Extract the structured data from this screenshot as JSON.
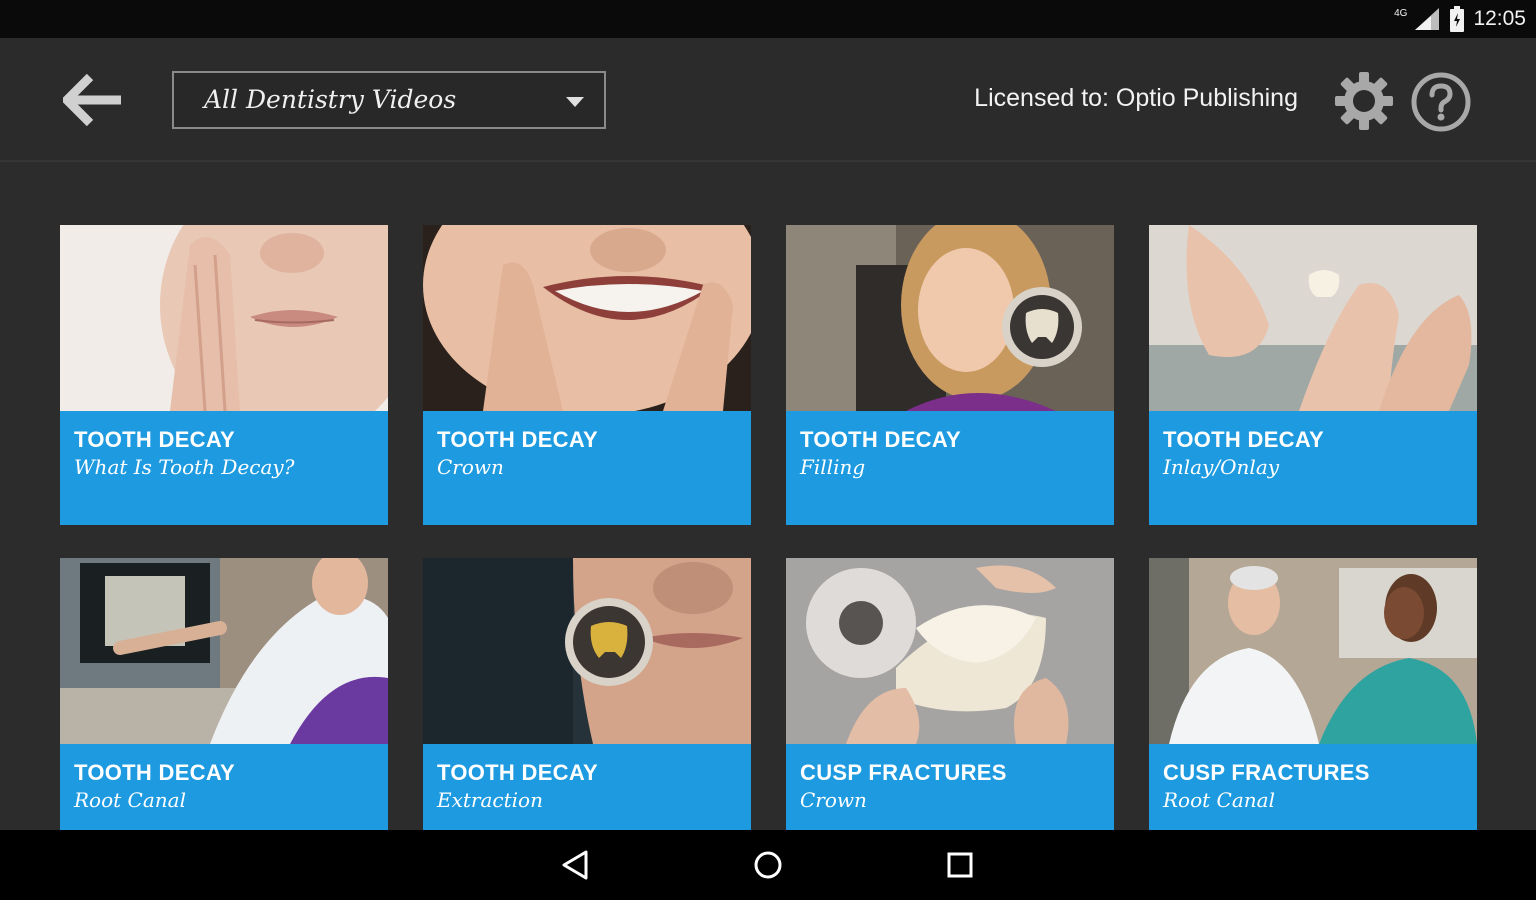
{
  "status_bar": {
    "time": "12:05",
    "network": "4G"
  },
  "header": {
    "dropdown_value": "All Dentistry Videos",
    "license_text": "Licensed to: Optio Publishing",
    "back_icon": "back-arrow-icon",
    "settings_icon": "gear-icon",
    "help_icon": "help-icon"
  },
  "colors": {
    "accent": "#1e9ae0",
    "background": "#2c2c2c",
    "status_bar": "#0a0a0a",
    "nav_bar": "#000000"
  },
  "videos": [
    {
      "title": "TOOTH DECAY",
      "subtitle": "What Is Tooth Decay?"
    },
    {
      "title": "TOOTH DECAY",
      "subtitle": "Crown"
    },
    {
      "title": "TOOTH DECAY",
      "subtitle": "Filling"
    },
    {
      "title": "TOOTH DECAY",
      "subtitle": "Inlay/Onlay"
    },
    {
      "title": "TOOTH DECAY",
      "subtitle": "Root Canal"
    },
    {
      "title": "TOOTH DECAY",
      "subtitle": "Extraction"
    },
    {
      "title": "CUSP FRACTURES",
      "subtitle": "Crown"
    },
    {
      "title": "CUSP FRACTURES",
      "subtitle": "Root Canal"
    }
  ],
  "nav": {
    "back": "nav-back-icon",
    "home": "nav-home-icon",
    "recents": "nav-recents-icon"
  }
}
